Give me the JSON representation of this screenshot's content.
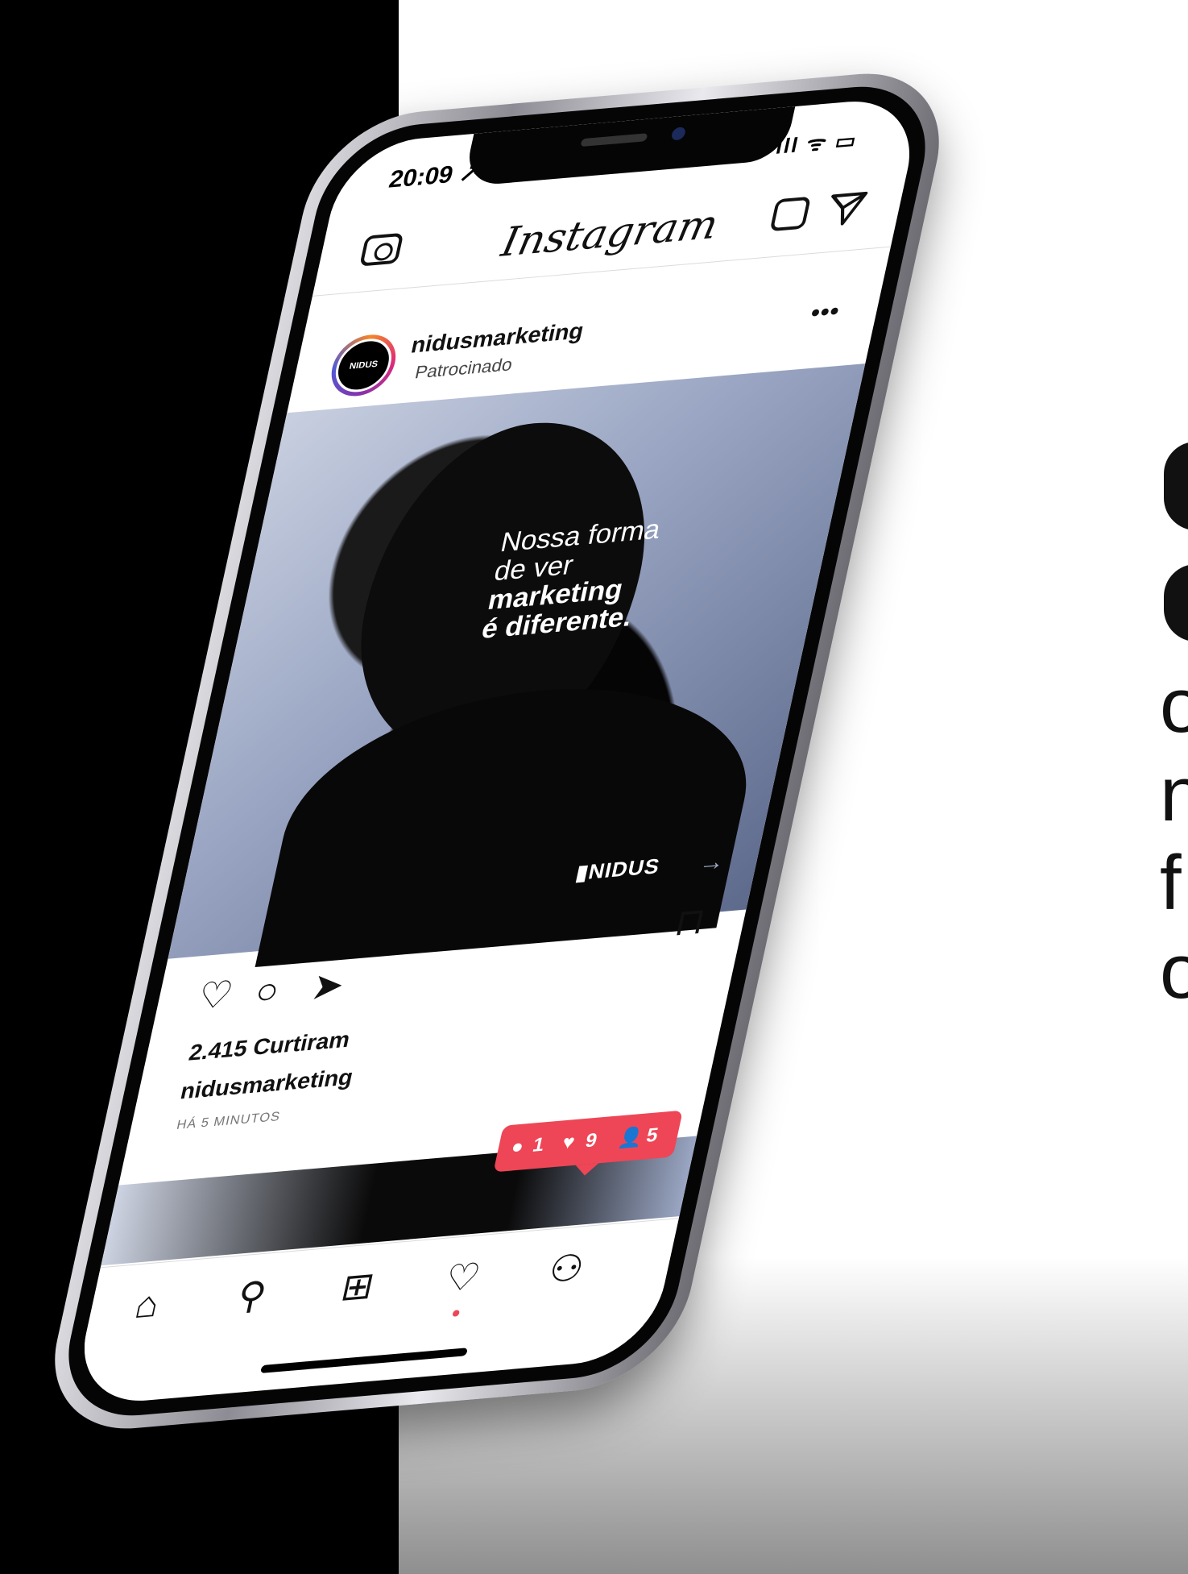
{
  "colors": {
    "accent": "#ee4656",
    "frame": "#8d8c94",
    "background_dark": "#000000"
  },
  "status_bar": {
    "time": "20:09 ↗",
    "signal": "ıll ᯤ ▭"
  },
  "top_bar": {
    "logo": "Instagram",
    "icons": {
      "camera": "camera-icon",
      "igtv": "igtv-icon",
      "direct": "paper-plane-icon"
    }
  },
  "post": {
    "username": "nidusmarketing",
    "sponsored_label": "Patrocinado",
    "avatar_text": "NIDUS",
    "more_label": "•••",
    "headline_line1": "Nossa forma",
    "headline_line2": "de ver",
    "headline_line3": "marketing",
    "headline_line4": "é diferente.",
    "brand_mark": "▮NIDUS",
    "likes": "2.415 Curtiram",
    "caption_user": "nidusmarketing",
    "time_ago": "HÁ 5 MINUTOS"
  },
  "actions": {
    "like": "♡",
    "comment": "○",
    "share": "➤",
    "save": "⊓"
  },
  "notification": {
    "comments": "1",
    "likes": "9",
    "followers": "5"
  },
  "tab_bar": {
    "home": "⌂",
    "search": "⚲",
    "add": "⊞",
    "activity": "♡",
    "profile": "⚇"
  },
  "right_text_fragments": [
    "o",
    "n",
    "f",
    "o"
  ]
}
